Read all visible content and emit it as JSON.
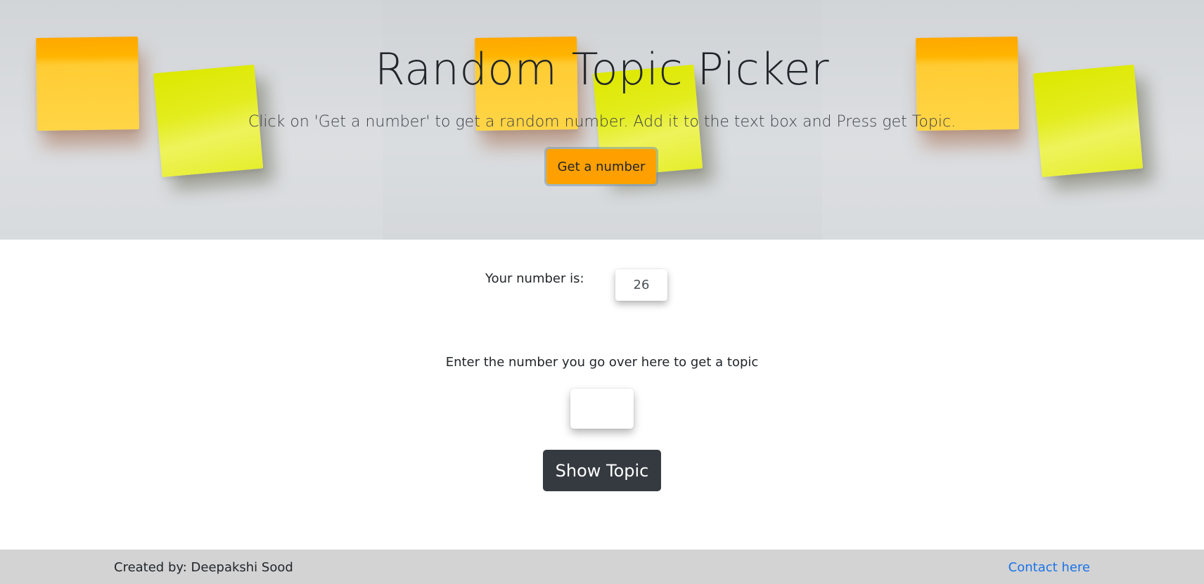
{
  "hero": {
    "title": "Random Topic Picker",
    "subtitle": "Click on 'Get a number' to get a random number. Add it to the text box and Press get Topic.",
    "get_number_label": "Get a number"
  },
  "main": {
    "number_label": "Your number is:",
    "number_value": "26",
    "topic_prompt": "Enter the number you go over here to get a topic",
    "topic_input_value": "",
    "show_topic_label": "Show Topic"
  },
  "footer": {
    "credit": "Created by: Deepakshi Sood",
    "contact_label": "Contact here"
  },
  "colors": {
    "accent_orange": "#ffa000",
    "dark_button": "#343a40",
    "footer_bg": "#d3d3d3",
    "link": "#1a73e8"
  }
}
